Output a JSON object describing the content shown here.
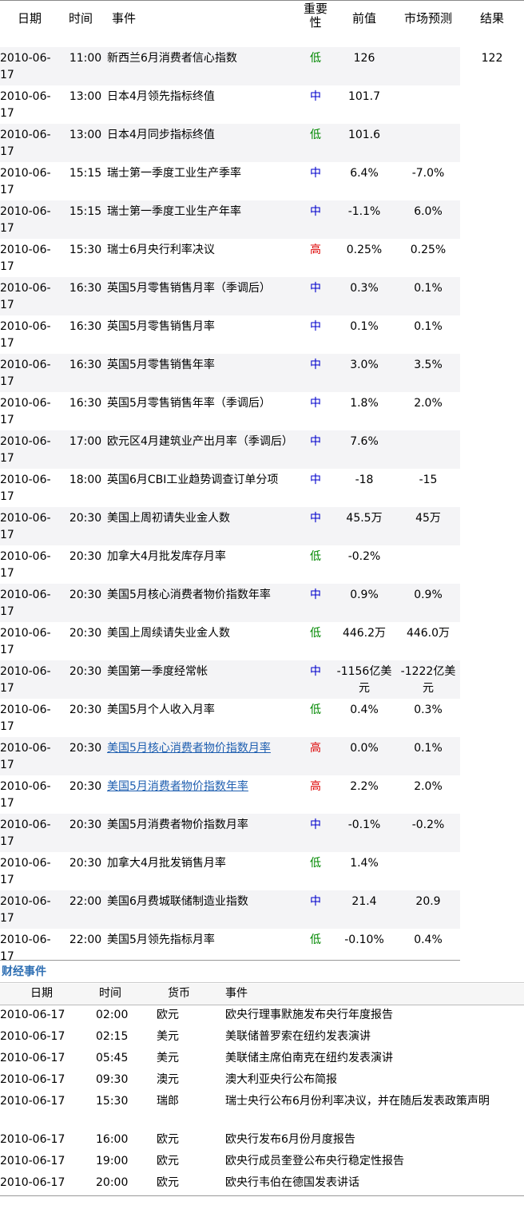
{
  "calendar": {
    "headers": {
      "date": "日期",
      "time": "时间",
      "event": "事件",
      "importance_line1": "重要",
      "importance_line2": "性",
      "previous": "前值",
      "forecast": "市场预测",
      "result": "结果"
    },
    "rows": [
      {
        "date_a": "2010-06-",
        "date_b": "17",
        "time": "11:00",
        "event": "新西兰6月消费者信心指数",
        "importance": "低",
        "level": "low",
        "previous": "126",
        "forecast": "",
        "result": "122",
        "link": false
      },
      {
        "date_a": "2010-06-",
        "date_b": "17",
        "time": "13:00",
        "event": "日本4月领先指标终值",
        "importance": "中",
        "level": "mid",
        "previous": "101.7",
        "forecast": "",
        "result": "",
        "link": false
      },
      {
        "date_a": "2010-06-",
        "date_b": "17",
        "time": "13:00",
        "event": "日本4月同步指标终值",
        "importance": "低",
        "level": "low",
        "previous": "101.6",
        "forecast": "",
        "result": "",
        "link": false
      },
      {
        "date_a": "2010-06-",
        "date_b": "17",
        "time": "15:15",
        "event": "瑞士第一季度工业生产季率",
        "importance": "中",
        "level": "mid",
        "previous": "6.4%",
        "forecast": "-7.0%",
        "result": "",
        "link": false
      },
      {
        "date_a": "2010-06-",
        "date_b": "17",
        "time": "15:15",
        "event": "瑞士第一季度工业生产年率",
        "importance": "中",
        "level": "mid",
        "previous": "-1.1%",
        "forecast": "6.0%",
        "result": "",
        "link": false
      },
      {
        "date_a": "2010-06-",
        "date_b": "17",
        "time": "15:30",
        "event": "瑞士6月央行利率决议",
        "importance": "高",
        "level": "high",
        "previous": "0.25%",
        "forecast": "0.25%",
        "result": "",
        "link": false
      },
      {
        "date_a": "2010-06-",
        "date_b": "17",
        "time": "16:30",
        "event": "英国5月零售销售月率（季调后）",
        "importance": "中",
        "level": "mid",
        "previous": "0.3%",
        "forecast": "0.1%",
        "result": "",
        "link": false
      },
      {
        "date_a": "2010-06-",
        "date_b": "17",
        "time": "16:30",
        "event": "英国5月零售销售月率",
        "importance": "中",
        "level": "mid",
        "previous": "0.1%",
        "forecast": "0.1%",
        "result": "",
        "link": false
      },
      {
        "date_a": "2010-06-",
        "date_b": "17",
        "time": "16:30",
        "event": "英国5月零售销售年率",
        "importance": "中",
        "level": "mid",
        "previous": "3.0%",
        "forecast": "3.5%",
        "result": "",
        "link": false
      },
      {
        "date_a": "2010-06-",
        "date_b": "17",
        "time": "16:30",
        "event": "英国5月零售销售年率（季调后）",
        "importance": "中",
        "level": "mid",
        "previous": "1.8%",
        "forecast": "2.0%",
        "result": "",
        "link": false
      },
      {
        "date_a": "2010-06-",
        "date_b": "17",
        "time": "17:00",
        "event": "欧元区4月建筑业产出月率（季调后）",
        "importance": "中",
        "level": "mid",
        "previous": "7.6%",
        "forecast": "",
        "result": "",
        "link": false
      },
      {
        "date_a": "2010-06-",
        "date_b": "17",
        "time": "18:00",
        "event": "英国6月CBI工业趋势调查订单分项",
        "importance": "中",
        "level": "mid",
        "previous": "-18",
        "forecast": "-15",
        "result": "",
        "link": false
      },
      {
        "date_a": "2010-06-",
        "date_b": "17",
        "time": "20:30",
        "event": "美国上周初请失业金人数",
        "importance": "中",
        "level": "mid",
        "previous": "45.5万",
        "forecast": "45万",
        "result": "",
        "link": false
      },
      {
        "date_a": "2010-06-",
        "date_b": "17",
        "time": "20:30",
        "event": "加拿大4月批发库存月率",
        "importance": "低",
        "level": "low",
        "previous": "-0.2%",
        "forecast": "",
        "result": "",
        "link": false
      },
      {
        "date_a": "2010-06-",
        "date_b": "17",
        "time": "20:30",
        "event": "美国5月核心消费者物价指数年率",
        "importance": "中",
        "level": "mid",
        "previous": "0.9%",
        "forecast": "0.9%",
        "result": "",
        "link": false
      },
      {
        "date_a": "2010-06-",
        "date_b": "17",
        "time": "20:30",
        "event": "美国上周续请失业金人数",
        "importance": "低",
        "level": "low",
        "previous": "446.2万",
        "forecast": "446.0万",
        "result": "",
        "link": false
      },
      {
        "date_a": "2010-06-",
        "date_b": "17",
        "time": "20:30",
        "event": "美国第一季度经常帐",
        "importance": "中",
        "level": "mid",
        "previous": "-1156亿美元",
        "forecast": "-1222亿美元",
        "result": "",
        "link": false
      },
      {
        "date_a": "2010-06-",
        "date_b": "17",
        "time": "20:30",
        "event": "美国5月个人收入月率",
        "importance": "低",
        "level": "low",
        "previous": "0.4%",
        "forecast": "0.3%",
        "result": "",
        "link": false
      },
      {
        "date_a": "2010-06-",
        "date_b": "17",
        "time": "20:30",
        "event": "美国5月核心消费者物价指数月率",
        "importance": "高",
        "level": "high",
        "previous": "0.0%",
        "forecast": "0.1%",
        "result": "",
        "link": true
      },
      {
        "date_a": "2010-06-",
        "date_b": "17",
        "time": "20:30",
        "event": "美国5月消费者物价指数年率",
        "importance": "高",
        "level": "high",
        "previous": "2.2%",
        "forecast": "2.0%",
        "result": "",
        "link": true
      },
      {
        "date_a": "2010-06-",
        "date_b": "17",
        "time": "20:30",
        "event": "美国5月消费者物价指数月率",
        "importance": "中",
        "level": "mid",
        "previous": "-0.1%",
        "forecast": "-0.2%",
        "result": "",
        "link": false
      },
      {
        "date_a": "2010-06-",
        "date_b": "17",
        "time": "20:30",
        "event": "加拿大4月批发销售月率",
        "importance": "低",
        "level": "low",
        "previous": "1.4%",
        "forecast": "",
        "result": "",
        "link": false
      },
      {
        "date_a": "2010-06-",
        "date_b": "17",
        "time": "22:00",
        "event": "美国6月费城联储制造业指数",
        "importance": "中",
        "level": "mid",
        "previous": "21.4",
        "forecast": "20.9",
        "result": "",
        "link": false
      },
      {
        "date_a": "2010-06-",
        "date_b": "17",
        "time": "22:00",
        "event": "美国5月领先指标月率",
        "importance": "低",
        "level": "low",
        "previous": "-0.10%",
        "forecast": "0.4%",
        "result": "",
        "link": false
      }
    ]
  },
  "finance_events": {
    "title": "财经事件",
    "headers": {
      "date": "日期",
      "time": "时间",
      "currency": "货币",
      "event": "事件"
    },
    "rows": [
      {
        "date": "2010-06-17",
        "time": "02:00",
        "currency": "欧元",
        "event": "欧央行理事默施发布央行年度报告"
      },
      {
        "date": "2010-06-17",
        "time": "02:15",
        "currency": "美元",
        "event": "美联储普罗索在纽约发表演讲"
      },
      {
        "date": "2010-06-17",
        "time": "05:45",
        "currency": "美元",
        "event": "美联储主席伯南克在纽约发表演讲"
      },
      {
        "date": "2010-06-17",
        "time": "09:30",
        "currency": "澳元",
        "event": "澳大利亚央行公布简报"
      },
      {
        "date": "2010-06-17",
        "time": "15:30",
        "currency": "瑞郎",
        "event": "瑞士央行公布6月份利率决议，并在随后发表政策声明"
      },
      {
        "date": "2010-06-17",
        "time": "16:00",
        "currency": "欧元",
        "event": "欧央行发布6月份月度报告"
      },
      {
        "date": "2010-06-17",
        "time": "19:00",
        "currency": "欧元",
        "event": "欧央行成员奎登公布央行稳定性报告"
      },
      {
        "date": "2010-06-17",
        "time": "20:00",
        "currency": "欧元",
        "event": "欧央行韦伯在德国发表讲话"
      }
    ]
  },
  "colors": {
    "importance_low": "#008800",
    "importance_mid": "#0000cc",
    "importance_high": "#dd0000",
    "link": "#1f5fb0",
    "section_title": "#2f6fb3",
    "row_shade": "#f4f4f6"
  }
}
